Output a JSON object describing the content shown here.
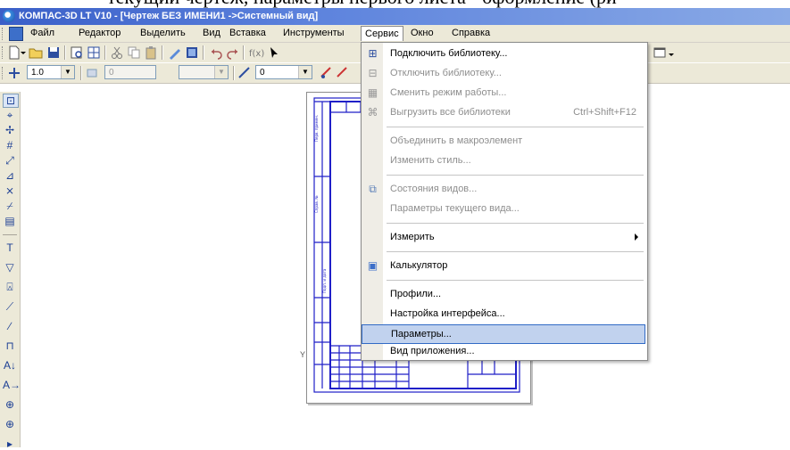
{
  "caption": {
    "text": "текущий чертеж, параметры первого листа - оформление (ри"
  },
  "window": {
    "title": "КОМПАС-3D LT V10 - [Чертеж БЕЗ ИМЕНИ1 ->Системный вид]"
  },
  "menubar": {
    "items": [
      "Файл",
      "Редактор",
      "Выделить",
      "Вид",
      "Вставка",
      "Инструменты",
      "Сервис",
      "Окно",
      "Справка"
    ]
  },
  "toolbar2": {
    "scale": "1.0",
    "layer": "0",
    "style": "0"
  },
  "service_menu": {
    "items": [
      {
        "label": "Подключить библиотеку...",
        "enabled": true,
        "icon": "library-connect-icon"
      },
      {
        "label": "Отключить библиотеку...",
        "enabled": false,
        "icon": "library-disconnect-icon"
      },
      {
        "label": "Сменить режим работы...",
        "enabled": false,
        "icon": "mode-icon"
      },
      {
        "label": "Выгрузить все библиотеки",
        "shortcut": "Ctrl+Shift+F12",
        "enabled": false,
        "icon": "unload-icon"
      },
      {
        "label": "Объединить в макроэлемент",
        "enabled": false
      },
      {
        "label": "Изменить стиль...",
        "enabled": false
      },
      {
        "label": "Состояния видов...",
        "enabled": false,
        "icon": "views-icon"
      },
      {
        "label": "Параметры текущего вида...",
        "enabled": false
      },
      {
        "label": "Измерить",
        "enabled": true,
        "submenu": true
      },
      {
        "label": "Калькулятор",
        "enabled": true,
        "icon": "calculator-icon"
      },
      {
        "label": "Профили...",
        "enabled": true
      },
      {
        "label": "Настройка интерфейса...",
        "enabled": true
      },
      {
        "label": "Параметры...",
        "enabled": true,
        "selected": true
      },
      {
        "label": "Вид приложения...",
        "enabled": true
      }
    ]
  },
  "colors": {
    "accent": "#316ac5",
    "title_start": "#3a5fc8",
    "drawing_lines": "#1f1fc8",
    "selection": "#c1d2ee"
  }
}
